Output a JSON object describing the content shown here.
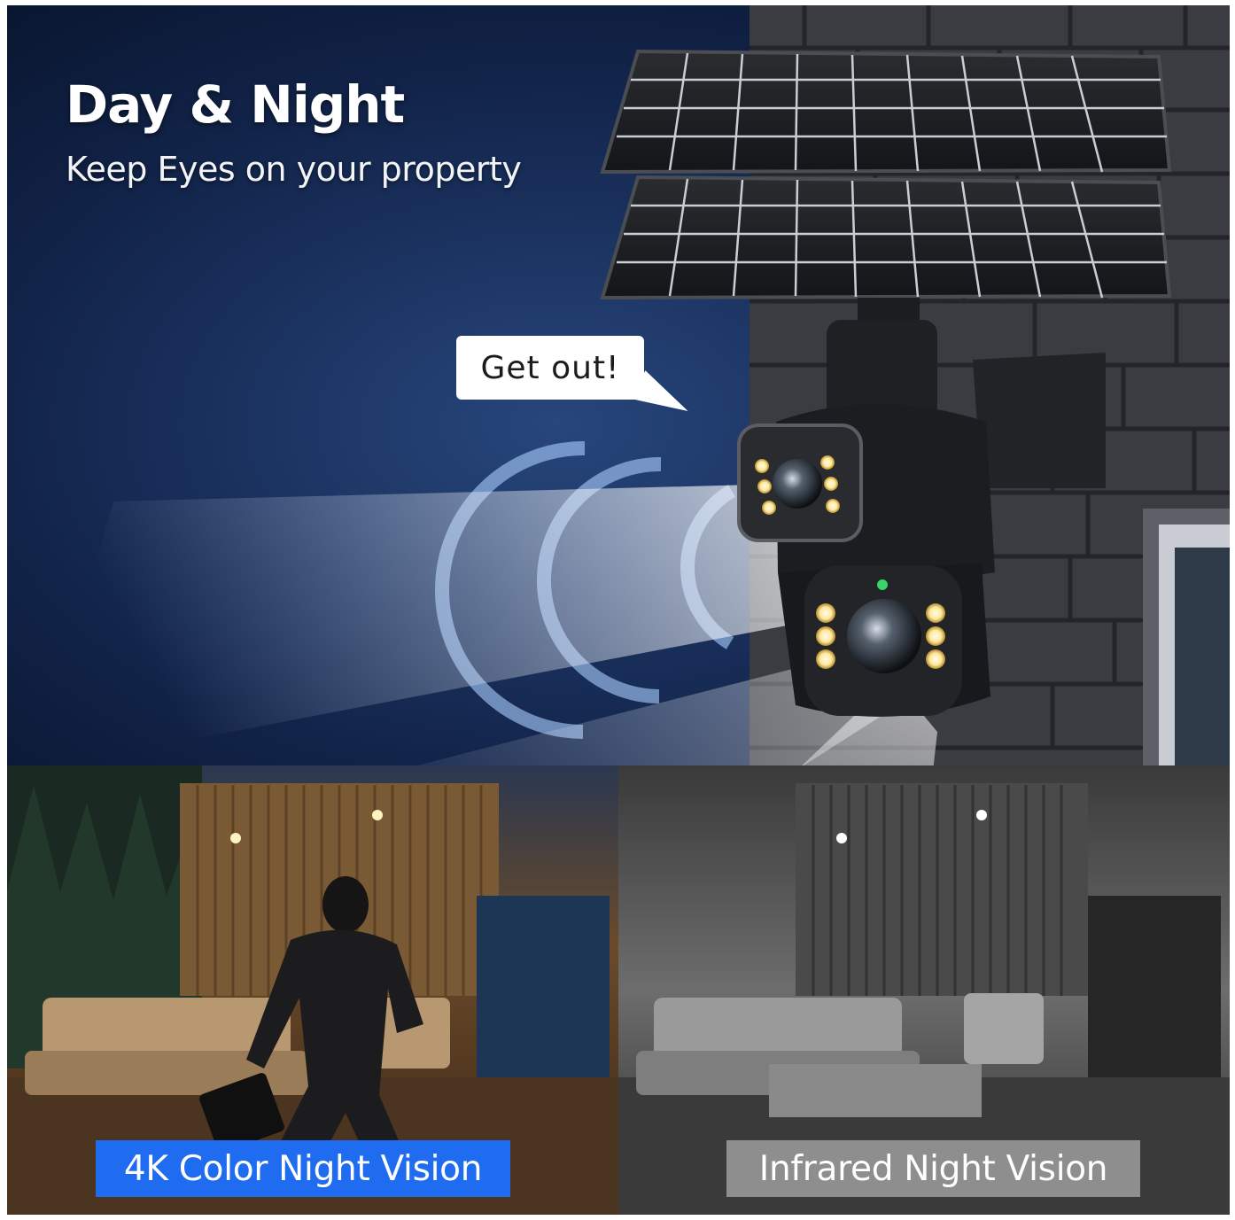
{
  "headline": "Day & Night",
  "subline": "Keep Eyes on your property",
  "speech_bubble": "Get out!",
  "badges": {
    "color_night_vision": "4K Color Night Vision",
    "infrared_night_vision": "Infrared Night Vision"
  },
  "colors": {
    "night_sky": "#0b1a38",
    "badge_blue": "#1f6cf0",
    "badge_gray": "#8e8e8e",
    "wall_stone": "#3e3f44",
    "camera_body": "#1c1d20"
  },
  "icons": [
    "solar-panel-icon",
    "security-camera-icon",
    "signal-waves-icon",
    "speech-bubble-icon"
  ]
}
